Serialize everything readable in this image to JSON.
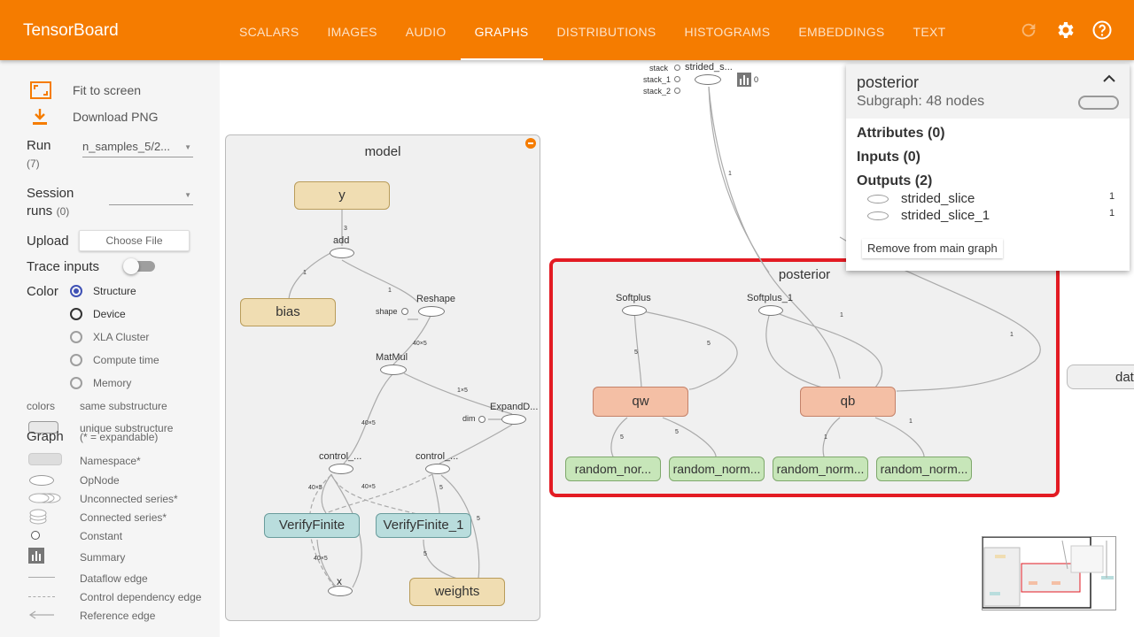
{
  "app": {
    "title": "TensorBoard"
  },
  "nav": {
    "tabs": [
      {
        "label": "SCALARS"
      },
      {
        "label": "IMAGES"
      },
      {
        "label": "AUDIO"
      },
      {
        "label": "GRAPHS"
      },
      {
        "label": "DISTRIBUTIONS"
      },
      {
        "label": "HISTOGRAMS"
      },
      {
        "label": "EMBEDDINGS"
      },
      {
        "label": "TEXT"
      }
    ],
    "active_tab": "GRAPHS",
    "icons": [
      "refresh-icon",
      "settings-icon",
      "help-icon"
    ]
  },
  "sidebar": {
    "fit_label": "Fit to screen",
    "download_label": "Download PNG",
    "run_label": "Run",
    "run_count": "(7)",
    "run_value": "n_samples_5/2...",
    "session_label": "Session",
    "session_label2": "runs",
    "session_count": "(0)",
    "upload_label": "Upload",
    "choose_file": "Choose File",
    "trace_label": "Trace inputs",
    "color_label": "Color",
    "color_options": [
      {
        "label": "Structure"
      },
      {
        "label": "Device"
      },
      {
        "label": "XLA Cluster"
      },
      {
        "label": "Compute time"
      },
      {
        "label": "Memory"
      }
    ],
    "colors_label": "colors",
    "same_sub": "same substructure",
    "unique_sub": "unique substructure",
    "graph_label": "Graph",
    "expandable": "(* = expandable)",
    "legend": [
      {
        "label": "Namespace*"
      },
      {
        "label": "OpNode"
      },
      {
        "label": "Unconnected series*"
      },
      {
        "label": "Connected series*"
      },
      {
        "label": "Constant"
      },
      {
        "label": "Summary"
      },
      {
        "label": "Dataflow edge"
      },
      {
        "label": "Control dependency edge"
      },
      {
        "label": "Reference edge"
      }
    ]
  },
  "graph": {
    "model": {
      "title": "model",
      "y": "y",
      "bias": "bias",
      "verify1": "VerifyFinite",
      "verify2": "VerifyFinite_1",
      "weights": "weights",
      "ops": {
        "add": "add",
        "reshape": "Reshape",
        "shape": "shape",
        "matmul": "MatMul",
        "expand": "ExpandD...",
        "dim": "dim",
        "control1": "control_...",
        "control2": "control_...",
        "x": "x"
      }
    },
    "posterior": {
      "title": "posterior",
      "qw": "qw",
      "qb": "qb",
      "softplus": "Softplus",
      "softplus1": "Softplus_1",
      "rn": [
        "random_nor...",
        "random_norm...",
        "random_norm...",
        "random_norm..."
      ]
    },
    "top": {
      "stack": "stack",
      "stack1": "stack_1",
      "stack2": "stack_2",
      "strided": "strided_s...",
      "zero": "0"
    },
    "data_label": "data"
  },
  "info_card": {
    "title": "posterior",
    "subtitle": "Subgraph: 48 nodes",
    "attributes": "Attributes (0)",
    "inputs": "Inputs (0)",
    "outputs": "Outputs (2)",
    "output_items": [
      {
        "name": "strided_slice",
        "count": "1"
      },
      {
        "name": "strided_slice_1",
        "count": "1"
      }
    ],
    "remove_button": "Remove from main graph"
  },
  "colors": {
    "accent": "#f57c00",
    "selection": "#e31b23"
  }
}
